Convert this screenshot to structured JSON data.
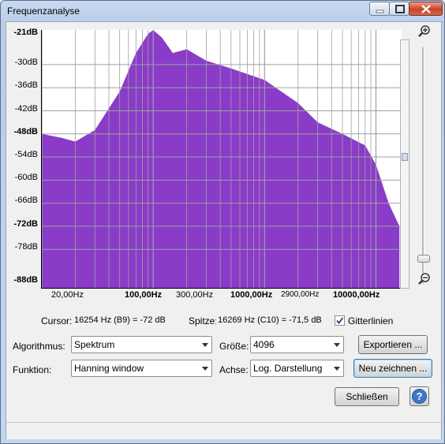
{
  "window": {
    "title": "Frequenzanalyse"
  },
  "y_axis": {
    "labels": [
      "-21dB",
      "-30dB",
      "-36dB",
      "-42dB",
      "-48dB",
      "-54dB",
      "-60dB",
      "-66dB",
      "-72dB",
      "-78dB",
      "-88dB"
    ]
  },
  "x_axis": {
    "labels": [
      "20,00Hz",
      "100,00Hz",
      "300,00Hz",
      "1000,00Hz",
      "2900,00Hz",
      "10000,00Hz"
    ]
  },
  "readouts": {
    "cursor_label": "Cursor:",
    "cursor_value": "16254 Hz (B9) = -72 dB",
    "peak_label": "Spitze:",
    "peak_value": "16269 Hz (C10) = -71,5 dB",
    "grid_label": "Gitterlinien",
    "grid_checked": true
  },
  "controls": {
    "algorithm_label": "Algorithmus:",
    "algorithm_value": "Spektrum",
    "size_label": "Größe:",
    "size_value": "4096",
    "export_label": "Exportieren ...",
    "function_label": "Funktion:",
    "function_value": "Hanning window",
    "axis_label": "Achse:",
    "axis_value": "Log. Darstellung",
    "redraw_label": "Neu zeichnen ...",
    "close_label": "Schließen",
    "help_label": "?"
  },
  "colors": {
    "spectrum": "#8a3cc8",
    "grid": "#a0a0a0"
  },
  "chart_data": {
    "type": "area",
    "xscale": "log",
    "ylim": [
      -88,
      -21
    ],
    "x": [
      10,
      15,
      20,
      30,
      50,
      70,
      90,
      100,
      120,
      150,
      200,
      300,
      500,
      1000,
      2000,
      3000,
      5000,
      8000,
      10000,
      13000,
      16254
    ],
    "values": [
      -48,
      -49,
      -50,
      -47,
      -37,
      -27,
      -22,
      -21,
      -23,
      -27,
      -26,
      -29,
      -31,
      -34,
      -40,
      -45,
      -48,
      -51,
      -56,
      -66,
      -72
    ]
  }
}
